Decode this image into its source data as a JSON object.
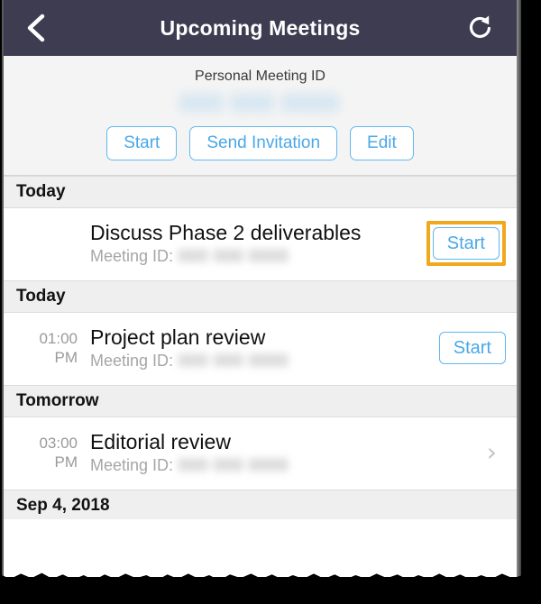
{
  "navbar": {
    "title": "Upcoming Meetings",
    "back_icon": "chevron-left-icon",
    "refresh_icon": "refresh-icon"
  },
  "pmi": {
    "label": "Personal Meeting ID",
    "number": "000 000 0000",
    "buttons": [
      {
        "label": "Start",
        "name": "pmi-start-button"
      },
      {
        "label": "Send Invitation",
        "name": "pmi-send-invitation-button"
      },
      {
        "label": "Edit",
        "name": "pmi-edit-button"
      }
    ]
  },
  "list": {
    "meeting_id_label": "Meeting ID:",
    "sections": [
      {
        "header": "Today",
        "rows": [
          {
            "time_hour": "",
            "time_meridiem": "",
            "title": "Discuss Phase 2 deliverables",
            "meeting_id": "000 000 0000",
            "action": "Start",
            "highlighted": true
          }
        ]
      },
      {
        "header": "Today",
        "rows": [
          {
            "time_hour": "01:00",
            "time_meridiem": "PM",
            "title": "Project plan review",
            "meeting_id": "000 000 0000",
            "action": "Start",
            "highlighted": false
          }
        ]
      },
      {
        "header": "Tomorrow",
        "rows": [
          {
            "time_hour": "03:00",
            "time_meridiem": "PM",
            "title": "Editorial review",
            "meeting_id": "000 000 0000",
            "action": "chevron",
            "highlighted": false
          }
        ]
      },
      {
        "header": "Sep 4, 2018",
        "rows": []
      }
    ]
  },
  "colors": {
    "navbar_bg": "#3d3c51",
    "accent_blue": "#4aa8e8",
    "highlight_orange": "#f0a81e",
    "section_bg": "#efefef"
  }
}
